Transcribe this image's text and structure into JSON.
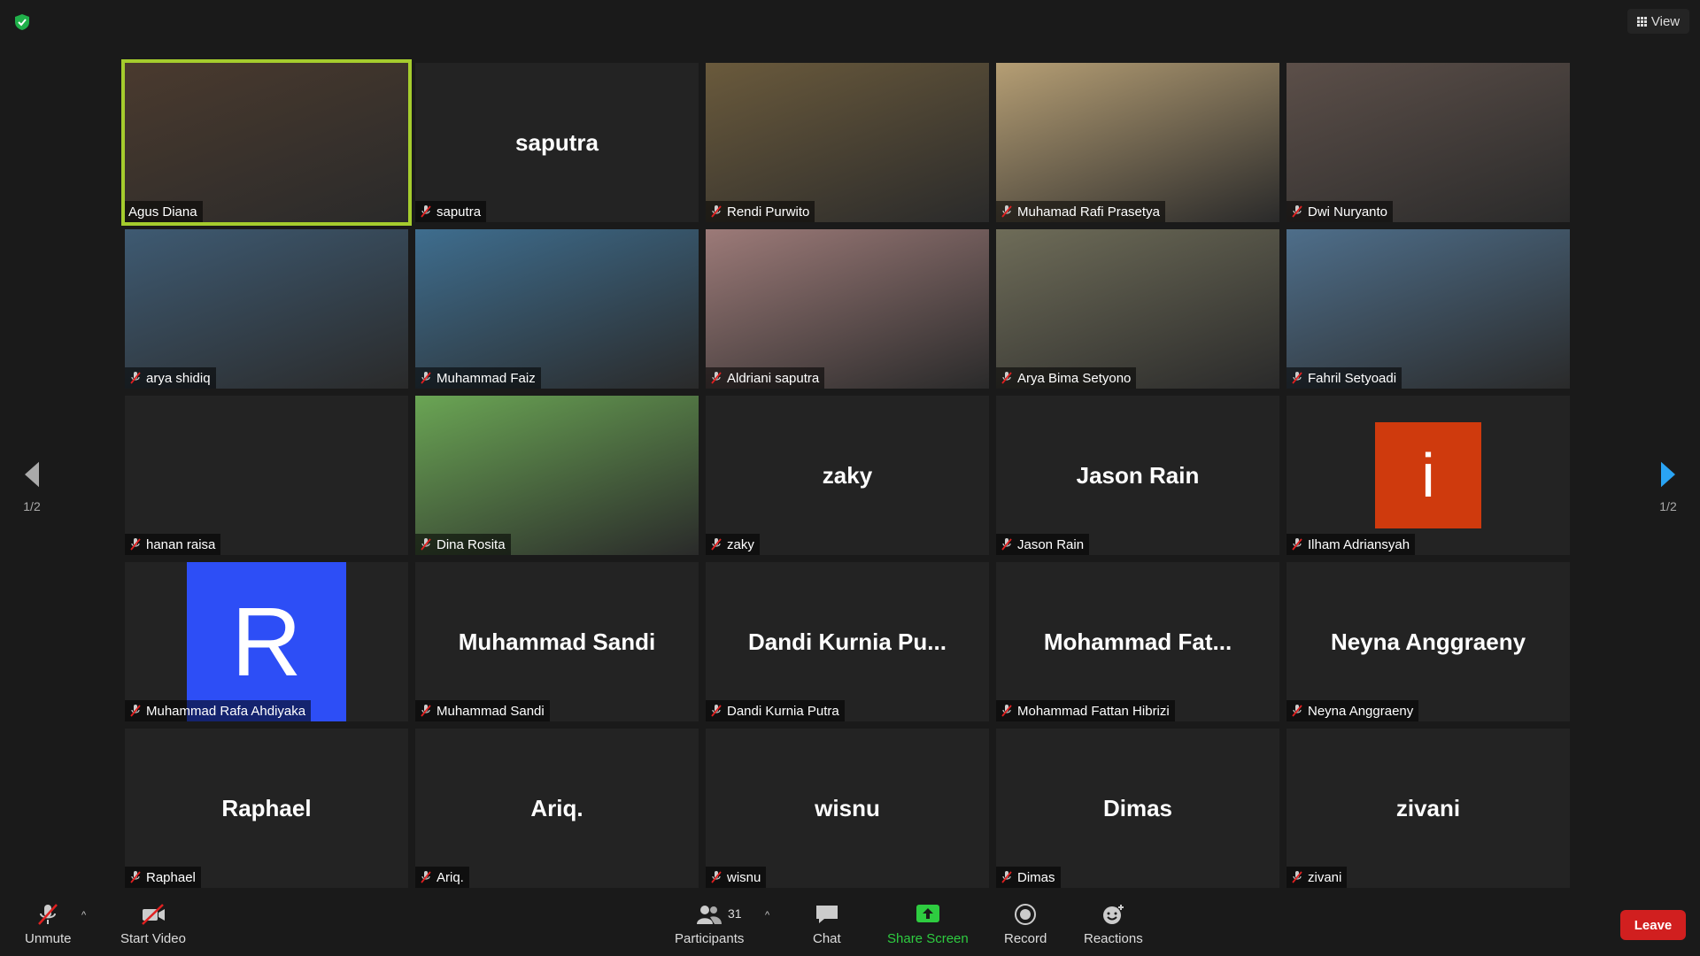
{
  "top": {
    "view_label": "View"
  },
  "nav": {
    "page_left": "1/2",
    "page_right": "1/2"
  },
  "tiles": [
    {
      "label": "Agus Diana",
      "center": "",
      "bg": "#4a3a2e",
      "muted": false,
      "active": true
    },
    {
      "label": "saputra",
      "center": "saputra",
      "bg": "",
      "muted": true
    },
    {
      "label": "Rendi Purwito",
      "center": "",
      "bg": "#6a5a3c",
      "muted": true
    },
    {
      "label": "Muhamad Rafi Prasetya",
      "center": "",
      "bg": "#b59e74",
      "muted": true
    },
    {
      "label": "Dwi Nuryanto",
      "center": "",
      "bg": "#5c4f49",
      "muted": true
    },
    {
      "label": "arya shidiq",
      "center": "",
      "bg": "#3e5a72",
      "muted": true
    },
    {
      "label": "Muhammad Faiz",
      "center": "",
      "bg": "#3e6d8e",
      "muted": true
    },
    {
      "label": "Aldriani saputra",
      "center": "",
      "bg": "#9c7a78",
      "muted": true
    },
    {
      "label": "Arya Bima Setyono",
      "center": "",
      "bg": "#6e6c58",
      "muted": true
    },
    {
      "label": "Fahril Setyoadi",
      "center": "",
      "bg": "#4e6e8a",
      "muted": true
    },
    {
      "label": "hanan raisa",
      "center": "",
      "bg": "",
      "muted": true
    },
    {
      "label": "Dina Rosita",
      "center": "",
      "bg": "#6aa554",
      "muted": true
    },
    {
      "label": "zaky",
      "center": "zaky",
      "bg": "",
      "muted": true
    },
    {
      "label": "Jason Rain",
      "center": "Jason Rain",
      "bg": "",
      "muted": true
    },
    {
      "label": "Ilham Adriansyah",
      "center": "",
      "bg": "",
      "muted": true,
      "avatar": "i"
    },
    {
      "label": "Muhammad Rafa Ahdiyaka",
      "center": "",
      "bg": "",
      "muted": true,
      "avatar": "R"
    },
    {
      "label": "Muhammad Sandi",
      "center": "Muhammad Sandi",
      "bg": "",
      "muted": true
    },
    {
      "label": "Dandi Kurnia Putra",
      "center": "Dandi Kurnia Pu...",
      "bg": "",
      "muted": true
    },
    {
      "label": "Mohammad Fattan Hibrizi",
      "center": "Mohammad Fat...",
      "bg": "",
      "muted": true
    },
    {
      "label": "Neyna Anggraeny",
      "center": "Neyna Anggraeny",
      "bg": "",
      "muted": true
    },
    {
      "label": "Raphael",
      "center": "Raphael",
      "bg": "",
      "muted": true
    },
    {
      "label": "Ariq.",
      "center": "Ariq.",
      "bg": "",
      "muted": true
    },
    {
      "label": "wisnu",
      "center": "wisnu",
      "bg": "",
      "muted": true
    },
    {
      "label": "Dimas",
      "center": "Dimas",
      "bg": "",
      "muted": true
    },
    {
      "label": "zivani",
      "center": "zivani",
      "bg": "",
      "muted": true
    }
  ],
  "toolbar": {
    "unmute": "Unmute",
    "start_video": "Start Video",
    "participants": "Participants",
    "participant_count": "31",
    "chat": "Chat",
    "share_screen": "Share Screen",
    "record": "Record",
    "reactions": "Reactions",
    "leave": "Leave"
  },
  "colors": {
    "accent_active": "#a5cc2d",
    "leave": "#d11f1f",
    "share": "#2ecc40",
    "avatar_r": "#2d4ef6",
    "avatar_i": "#cf3a0d"
  }
}
